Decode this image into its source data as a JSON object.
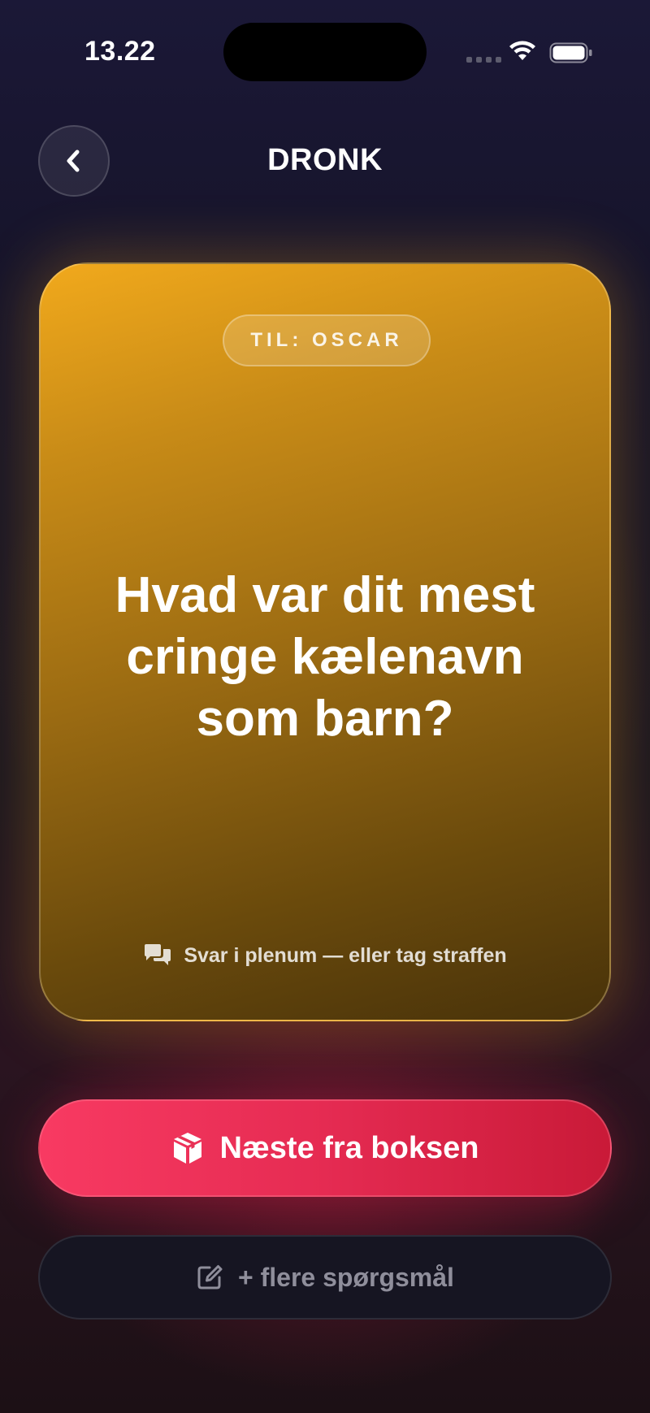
{
  "status_bar": {
    "time": "13.22"
  },
  "header": {
    "title": "DRONK",
    "back_icon": "chevron-left-icon"
  },
  "card": {
    "recipient": "TIL: OSCAR",
    "question": "Hvad var dit mest cringe kælenavn som barn?",
    "hint": "Svar i plenum — eller tag straffen",
    "hint_icon": "chat-bubbles-icon",
    "gradient_top": "#f1a91c",
    "gradient_bottom": "#48320a"
  },
  "actions": {
    "next_label": "Næste fra boksen",
    "next_icon": "box-icon",
    "next_color": "#e52b52",
    "more_label": "+ flere spørgsmål",
    "more_icon": "edit-icon"
  }
}
